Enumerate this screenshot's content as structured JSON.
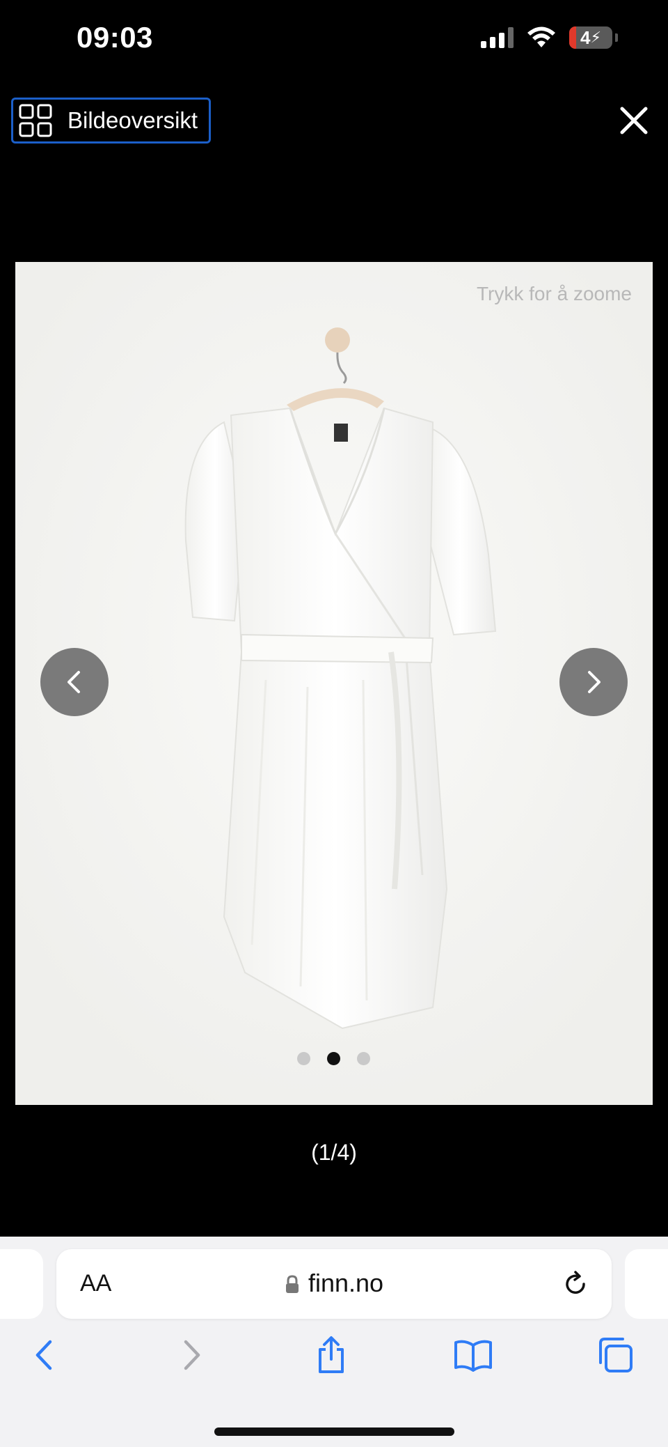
{
  "status_bar": {
    "time": "09:03",
    "battery": "4"
  },
  "header": {
    "overview_label": "Bildeoversikt",
    "overview_icon": "grid-icon",
    "close_icon": "close-icon"
  },
  "gallery": {
    "zoom_hint": "Trykk for å zoome",
    "counter": "(1/4)",
    "dots_total": 3,
    "dots_active": 2
  },
  "browser": {
    "text_size_label": "AA",
    "url": "finn.no",
    "toolbar_icons": [
      "back-icon",
      "forward-icon",
      "share-icon",
      "bookmarks-icon",
      "tabs-icon"
    ]
  },
  "colors": {
    "accent": "#1b5fc9",
    "link_blue": "#2f7cf6",
    "background": "#000000"
  }
}
